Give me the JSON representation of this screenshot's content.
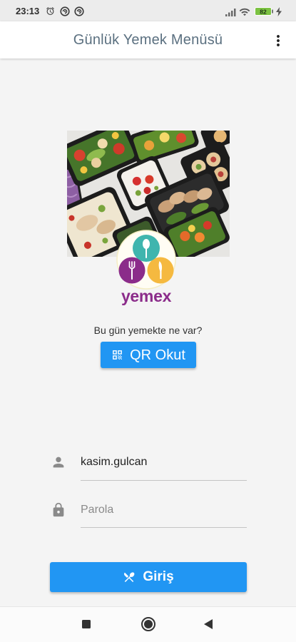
{
  "status_bar": {
    "time": "23:13",
    "battery_level": "82",
    "icons": [
      "alarm-icon",
      "app-notification-icon",
      "app-notification-icon",
      "signal-icon",
      "wifi-icon",
      "battery-icon",
      "charging-icon"
    ]
  },
  "app_bar": {
    "title": "Günlük Yemek Menüsü",
    "menu_icon": "more-vert-icon"
  },
  "hero": {
    "image": "food-trays-photo",
    "logo_text": "yemex"
  },
  "qr_section": {
    "prompt": "Bu gün yemekte ne var?",
    "button_label": "QR Okut",
    "button_icon": "qr-code-icon"
  },
  "login": {
    "username": {
      "value": "kasim.gulcan",
      "icon": "person-icon"
    },
    "password": {
      "placeholder": "Parola",
      "icon": "lock-icon"
    },
    "submit": {
      "label": "Giriş",
      "icon": "restaurant-icon"
    }
  },
  "nav_bar": {
    "icons": [
      "recents-icon",
      "home-icon",
      "back-icon"
    ]
  },
  "colors": {
    "primary": "#2196F3",
    "title": "#5B7080",
    "logo_purple": "#8B2C8A",
    "logo_teal": "#3FB5AE",
    "logo_orange": "#F5B940",
    "battery": "#7CC242",
    "background": "#F4F4F4"
  }
}
